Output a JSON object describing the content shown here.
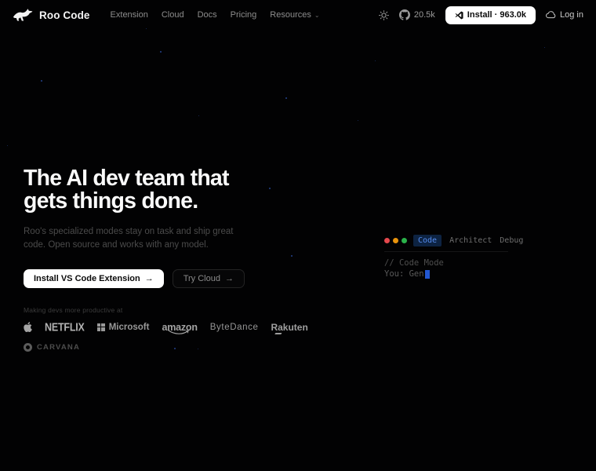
{
  "navbar": {
    "brand": "Roo Code",
    "links": [
      {
        "label": "Extension"
      },
      {
        "label": "Cloud"
      },
      {
        "label": "Docs"
      },
      {
        "label": "Pricing"
      },
      {
        "label": "Resources"
      }
    ],
    "resources_caret": "⌄",
    "github_stars": "20.5k",
    "install_label": "Install · 963.0k",
    "login_label": "Log in"
  },
  "hero": {
    "title_line1": "The AI dev team that",
    "title_line2": "gets things done.",
    "subtitle": "Roo's specialized modes stay on task and ship great code. Open source and works with any model.",
    "primary_cta": "Install VS Code Extension",
    "secondary_cta": "Try Cloud",
    "arrow": "→",
    "social_proof_label": "Making devs more productive at",
    "companies": [
      "Apple",
      "Netflix",
      "Microsoft",
      "Amazon",
      "ByteDance",
      "Rakuten",
      "Carvana"
    ]
  },
  "editor": {
    "tabs": [
      {
        "label": "Code",
        "active": true
      },
      {
        "label": "Architect",
        "active": false
      },
      {
        "label": "Debug",
        "active": false
      }
    ],
    "code_line1": "// Code Mode",
    "code_line2": "You: Gen"
  },
  "colors": {
    "background": "#020203",
    "accent_blue": "#568df0",
    "active_tab_bg": "#0d2342",
    "traffic_red": "#e5484d",
    "traffic_amber": "#e8930c",
    "traffic_green": "#2ab24a",
    "primary_button_bg": "#ffffff",
    "star_particle": "#24418c"
  }
}
